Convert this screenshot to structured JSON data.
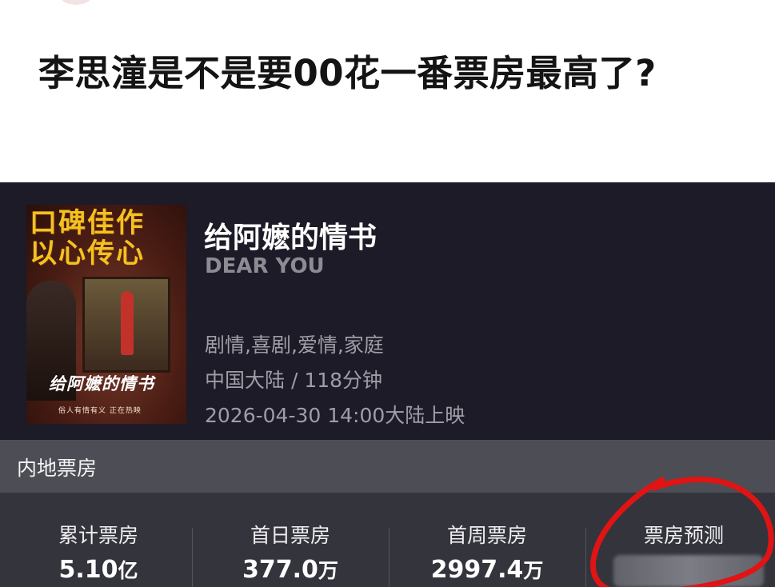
{
  "post": {
    "title": "李思潼是不是要00花一番票房最高了?"
  },
  "movie": {
    "title": "给阿嬷的情书",
    "english_title": "DEAR YOU",
    "genres": "剧情,喜剧,爱情,家庭",
    "region_duration": "中国大陆 / 118分钟",
    "release": "2026-04-30 14:00大陆上映",
    "poster": {
      "slogan_line1": "口碑佳作",
      "slogan_line2": "以心传心",
      "title": "给阿嬷的情书",
      "tagline": "俗人有情有义  正在热映"
    }
  },
  "boxoffice": {
    "section_title": "内地票房",
    "stats": [
      {
        "label": "累计票房",
        "value": "5.10",
        "unit": "亿"
      },
      {
        "label": "首日票房",
        "value": "377.0",
        "unit": "万"
      },
      {
        "label": "首周票房",
        "value": "2997.4",
        "unit": "万"
      },
      {
        "label": "票房预测",
        "value": "",
        "unit": ""
      }
    ]
  },
  "colors": {
    "card_bg": "#1c1b27",
    "section_header_bg": "#4d4d55",
    "stats_bg": "#34343c",
    "slogan_yellow": "#f3c21f",
    "annotation_red": "#e01414"
  }
}
